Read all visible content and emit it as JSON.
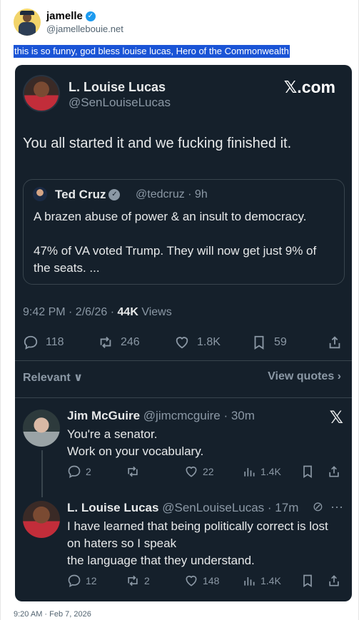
{
  "outer_post": {
    "author_name": "jamelle",
    "author_handle": "@jamellebouie.net",
    "text": "this is so funny, god bless louise lucas, Hero of the Commonwealth",
    "timestamp": "9:20 AM · Feb 7, 2026"
  },
  "screenshot": {
    "brand": "𝕏.com",
    "main_tweet": {
      "name": "L. Louise Lucas",
      "handle": "@SenLouiseLucas",
      "text": "You all started it and we fucking finished it.",
      "meta_time": "9:42 PM · 2/6/26 · ",
      "views_count": "44K",
      "views_label": " Views",
      "replies": "118",
      "reposts": "246",
      "likes": "1.8K",
      "bookmarks": "59"
    },
    "quoted": {
      "name": "Ted Cruz",
      "handle": "@tedcruz · 9h",
      "text": "A brazen abuse of power & an insult to democracy.\n\n47% of VA voted Trump. They will now get just 9% of the seats. ..."
    },
    "sort_label": "Relevant ∨",
    "view_quotes": "View quotes ›",
    "replies": [
      {
        "name": "Jim McGuire",
        "handle": "@jimcmcguire · 30m",
        "text": "You're a senator.\nWork on your vocabulary.",
        "replies": "2",
        "reposts": "",
        "likes": "22",
        "views": "1.4K"
      },
      {
        "name": "L. Louise Lucas",
        "handle": "@SenLouiseLucas · 17m",
        "text": "I have learned that being politically correct is lost on haters so I speak\nthe language that they understand.",
        "replies": "12",
        "reposts": "2",
        "likes": "148",
        "views": "1.4K"
      }
    ]
  },
  "colors": {
    "card_bg": "#15202b",
    "highlight": "#1a54d6",
    "verified": "#1d9bf0"
  }
}
